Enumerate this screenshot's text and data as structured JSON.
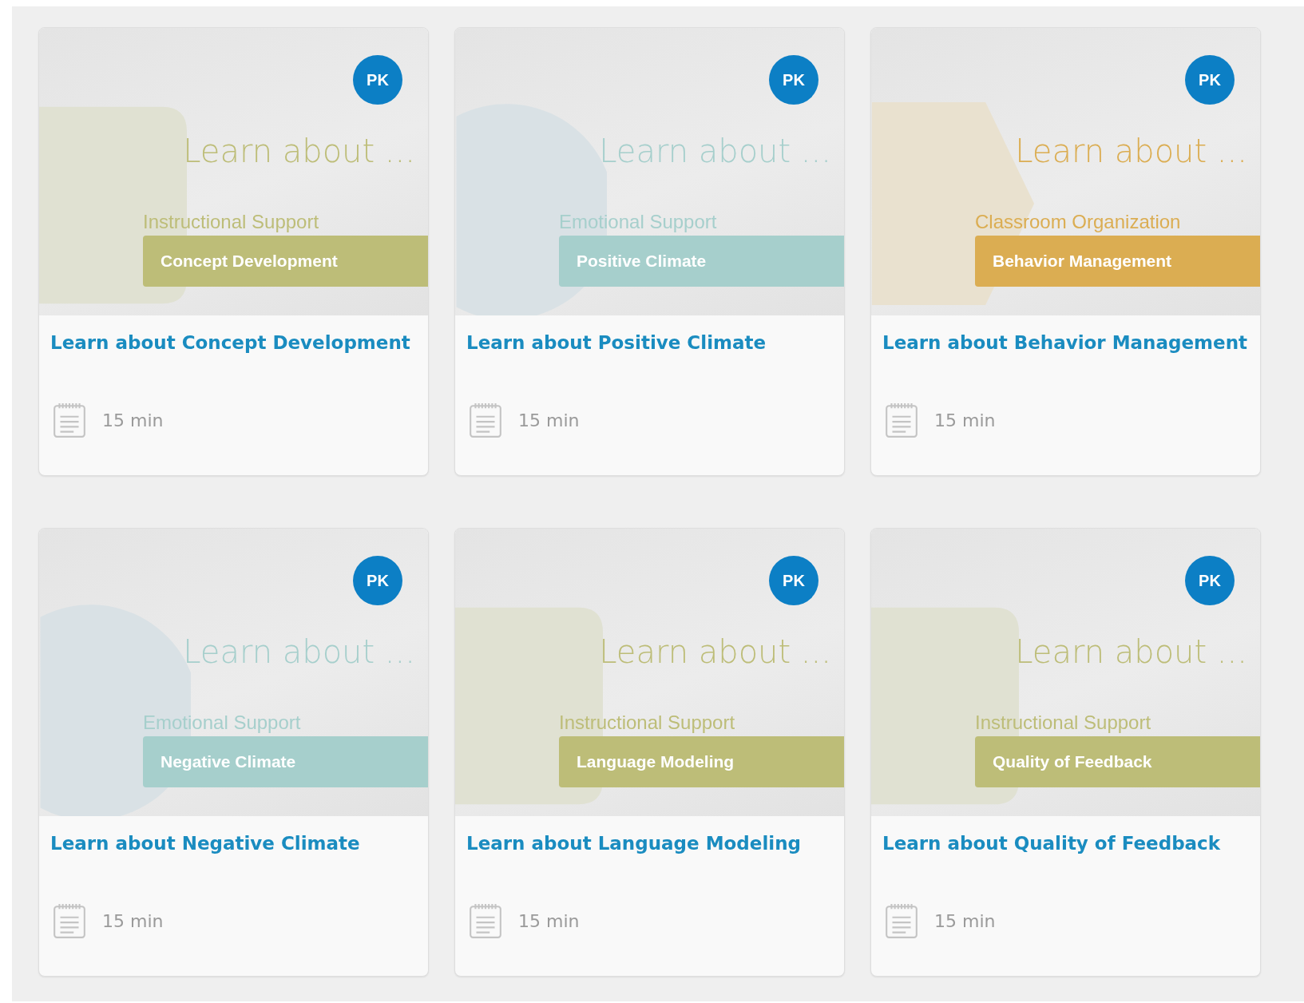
{
  "cards": [
    {
      "badge": "PK",
      "headline": "Learn about ...",
      "domain": "Instructional Support",
      "dimension": "Concept Development",
      "color": "#bdbd78",
      "kind": "square",
      "title": "Learn about Concept Development",
      "duration": "15 min"
    },
    {
      "badge": "PK",
      "headline": "Learn about ...",
      "domain": "Emotional Support",
      "dimension": "Positive Climate",
      "color": "#a6cfcc",
      "kind": "circle",
      "title": "Learn about Positive Climate",
      "duration": "15 min"
    },
    {
      "badge": "PK",
      "headline": "Learn about ...",
      "domain": "Classroom Organization",
      "dimension": "Behavior Management",
      "color": "#dbad52",
      "kind": "hexagon",
      "title": "Learn about Behavior Management",
      "duration": "15 min"
    },
    {
      "badge": "PK",
      "headline": "Learn about ...",
      "domain": "Emotional Support",
      "dimension": "Negative Climate",
      "color": "#a6cfcc",
      "kind": "circle",
      "title": "Learn about Negative Climate",
      "duration": "15 min"
    },
    {
      "badge": "PK",
      "headline": "Learn about ...",
      "domain": "Instructional Support",
      "dimension": "Language Modeling",
      "color": "#bdbd78",
      "kind": "square",
      "title": "Learn about Language Modeling",
      "duration": "15 min"
    },
    {
      "badge": "PK",
      "headline": "Learn about ...",
      "domain": "Instructional Support",
      "dimension": "Quality of Feedback",
      "color": "#bdbd78",
      "kind": "square",
      "title": "Learn about Quality of Feedback",
      "duration": "15 min"
    }
  ]
}
